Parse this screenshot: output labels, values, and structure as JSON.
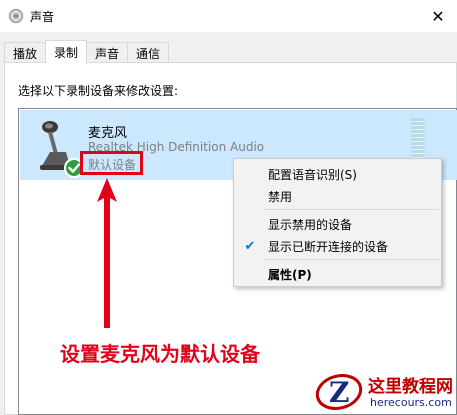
{
  "window": {
    "title": "声音",
    "close_label": "✕"
  },
  "tabs": [
    {
      "label": "播放",
      "active": false
    },
    {
      "label": "录制",
      "active": true
    },
    {
      "label": "声音",
      "active": false
    },
    {
      "label": "通信",
      "active": false
    }
  ],
  "recording": {
    "instruction": "选择以下录制设备来修改设置:",
    "device": {
      "name": "麦克风",
      "driver": "Realtek High Definition Audio",
      "status": "默认设备",
      "icon": "microphone-icon",
      "default_badge": "green-check-icon"
    }
  },
  "context_menu": {
    "items": [
      {
        "label": "配置语音识别(S)",
        "checked": false,
        "bold": false
      },
      {
        "label": "禁用",
        "checked": false,
        "bold": false
      },
      {
        "label": "显示禁用的设备",
        "checked": false,
        "bold": false
      },
      {
        "label": "显示已断开连接的设备",
        "checked": true,
        "bold": false
      },
      {
        "label": "属性(P)",
        "checked": false,
        "bold": true
      }
    ]
  },
  "annotation": {
    "text": "设置麦克风为默认设备",
    "color": "#e3001b"
  },
  "watermark": {
    "title": "这里教程网",
    "url": "herecours.com",
    "logo_letter": "Z"
  },
  "colors": {
    "selection": "#cce8ff",
    "accent": "#0078d7",
    "annotation_red": "#e3001b"
  }
}
